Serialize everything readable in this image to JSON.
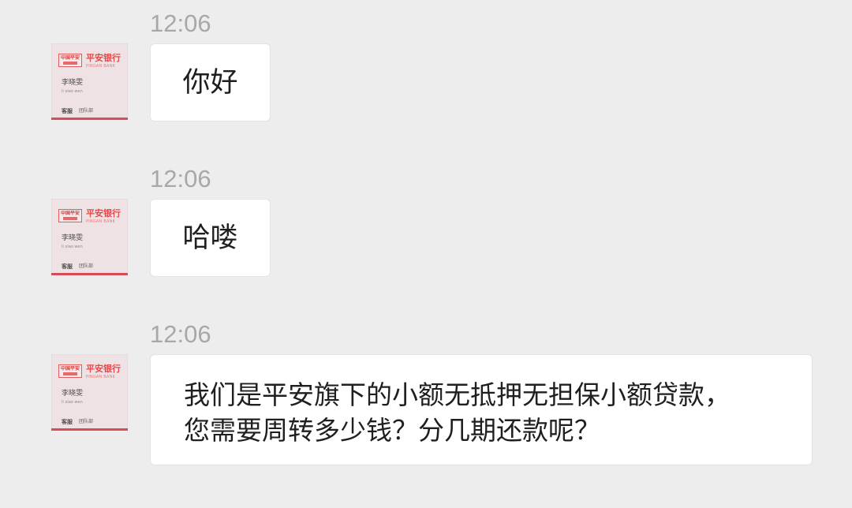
{
  "avatar": {
    "bank_name_cn": "平安银行",
    "bank_name_en": "PINGAN BANK",
    "group_name": "中国平安",
    "person_name": "李晓雯",
    "person_pinyin": "li xiao wen",
    "role": "客服",
    "department": "团队部"
  },
  "messages": [
    {
      "time": "12:06",
      "text": "你好"
    },
    {
      "time": "12:06",
      "text": "哈喽"
    },
    {
      "time": "12:06",
      "lines": [
        "我们是平安旗下的小额无抵押无担保小额贷款，",
        "您需要周转多少钱？分几期还款呢？"
      ]
    }
  ],
  "colors": {
    "background": "#ededed",
    "bubble": "#ffffff",
    "timestamp": "#a8a8a8",
    "brand_red": "#e24b4b"
  }
}
